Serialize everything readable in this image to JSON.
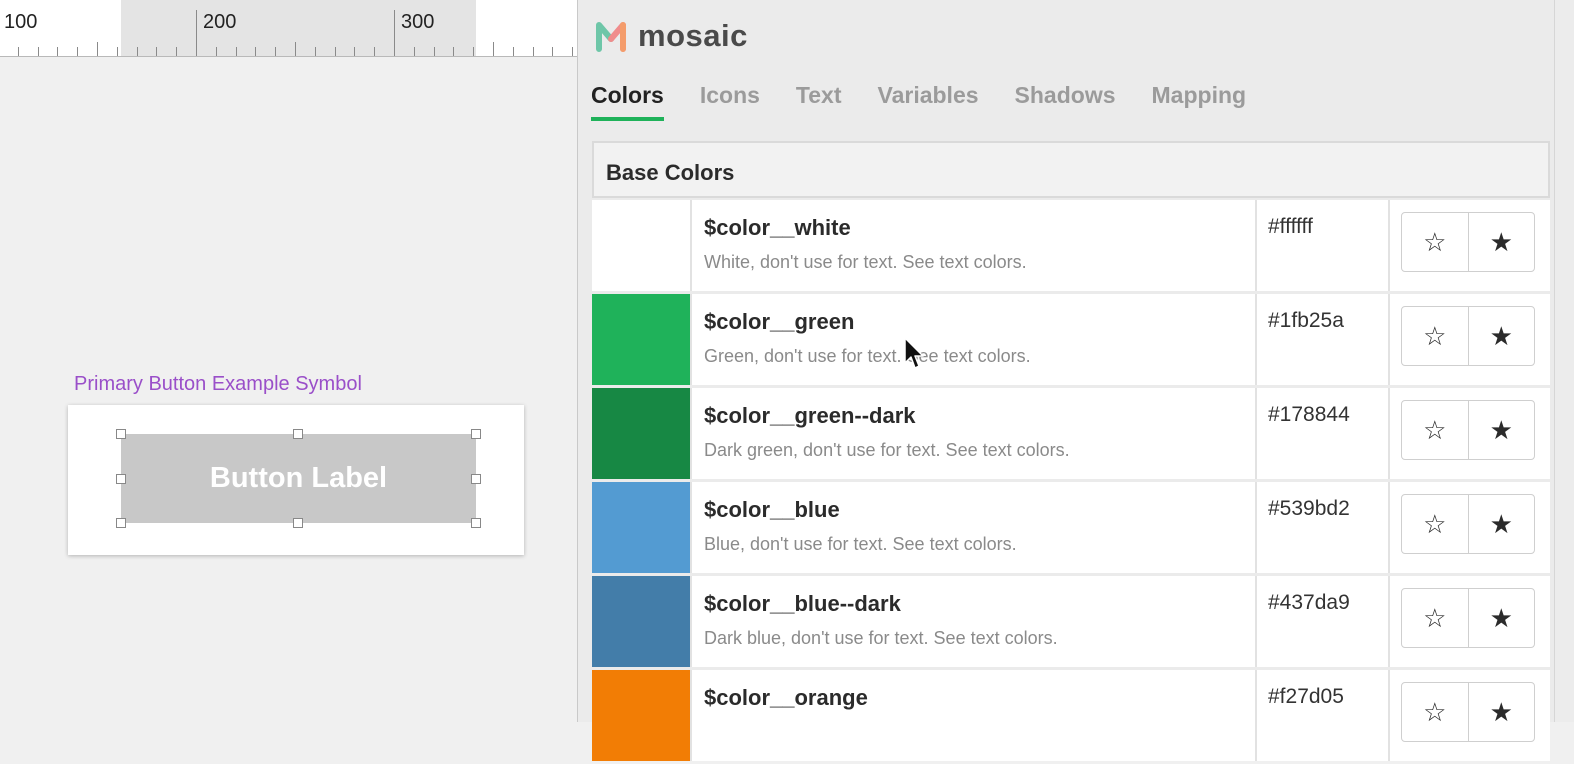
{
  "ruler": {
    "labels": [
      "100",
      "200",
      "300"
    ]
  },
  "canvas": {
    "symbol_label": "Primary Button Example Symbol",
    "button_label": "Button Label"
  },
  "brand": {
    "name": "mosaic",
    "logo_icon": "mosaic-m-logo-icon"
  },
  "tabs": [
    {
      "label": "Colors",
      "active": true
    },
    {
      "label": "Icons",
      "active": false
    },
    {
      "label": "Text",
      "active": false
    },
    {
      "label": "Variables",
      "active": false
    },
    {
      "label": "Shadows",
      "active": false
    },
    {
      "label": "Mapping",
      "active": false
    }
  ],
  "section": {
    "title": "Base Colors"
  },
  "colors": [
    {
      "name": "$color__white",
      "description": "White, don't use for text. See text colors.",
      "hex": "#ffffff"
    },
    {
      "name": "$color__green",
      "description": "Green, don't use for text. See text colors.",
      "hex": "#1fb25a"
    },
    {
      "name": "$color__green--dark",
      "description": "Dark green, don't use for text. See text colors.",
      "hex": "#178844"
    },
    {
      "name": "$color__blue",
      "description": "Blue, don't use for text. See text colors.",
      "hex": "#539bd2"
    },
    {
      "name": "$color__blue--dark",
      "description": "Dark blue, don't use for text. See text colors.",
      "hex": "#437da9"
    },
    {
      "name": "$color__orange",
      "description": "",
      "hex": "#f27d05"
    }
  ],
  "actions": {
    "outline_star": "☆",
    "filled_star": "★"
  }
}
